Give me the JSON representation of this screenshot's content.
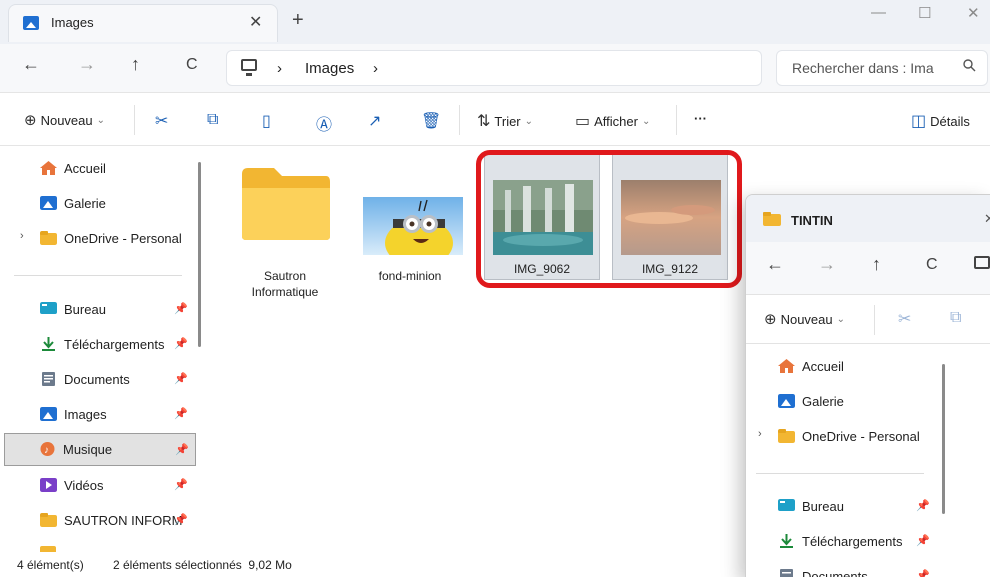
{
  "window": {
    "tab_title": "Images",
    "tab_close": "✕",
    "new_tab": "+",
    "minimize": "—",
    "maximize": "☐",
    "close": "✕"
  },
  "nav": {
    "back": "←",
    "forward": "→",
    "up": "↑",
    "refresh": "C",
    "breadcrumb_sep": "›",
    "breadcrumb": [
      "Images"
    ],
    "breadcrumb_trailing": "›",
    "search_placeholder": "Rechercher dans : Ima",
    "search_icon": "search-icon"
  },
  "toolbar": {
    "new_label": "Nouveau",
    "sort_label": "Trier",
    "view_label": "Afficher",
    "more_label": "···",
    "details_label": "Détails"
  },
  "sidebar": {
    "items": [
      {
        "label": "Accueil",
        "icon": "home-icon",
        "color": "#e8743b"
      },
      {
        "label": "Galerie",
        "icon": "gallery-icon",
        "color": "#1f6fd1"
      },
      {
        "label": "OneDrive - Personal",
        "icon": "folder-icon",
        "color": "#f2b632"
      },
      {
        "label": "Bureau",
        "icon": "desktop-icon",
        "color": "#1ea0c8"
      },
      {
        "label": "Téléchargements",
        "icon": "download-icon",
        "color": "#1c8a3a"
      },
      {
        "label": "Documents",
        "icon": "documents-icon",
        "color": "#6c7a8c"
      },
      {
        "label": "Images",
        "icon": "images-icon",
        "color": "#1f6fd1"
      },
      {
        "label": "Musique",
        "icon": "music-icon",
        "color": "#e8743b"
      },
      {
        "label": "Vidéos",
        "icon": "videos-icon",
        "color": "#7a3fc8"
      },
      {
        "label": "SAUTRON INFORM",
        "icon": "folder-icon",
        "color": "#f2b632"
      }
    ]
  },
  "files": [
    {
      "name_line1": "Sautron",
      "name_line2": "Informatique",
      "type": "folder",
      "selected": false
    },
    {
      "name": "fond-minion",
      "type": "image",
      "selected": false
    },
    {
      "name": "IMG_9062",
      "type": "image",
      "selected": true
    },
    {
      "name": "IMG_9122",
      "type": "image",
      "selected": true
    }
  ],
  "status": {
    "count": "4 élément(s)",
    "selection": "2 éléments sélectionnés  9,02 Mo"
  },
  "window2": {
    "title": "TINTIN",
    "tab_close": "✕",
    "new_label": "Nouveau",
    "sidebar": [
      {
        "label": "Accueil"
      },
      {
        "label": "Galerie"
      },
      {
        "label": "OneDrive - Personal"
      },
      {
        "label": "Bureau"
      },
      {
        "label": "Téléchargements"
      },
      {
        "label": "Documents"
      }
    ]
  }
}
